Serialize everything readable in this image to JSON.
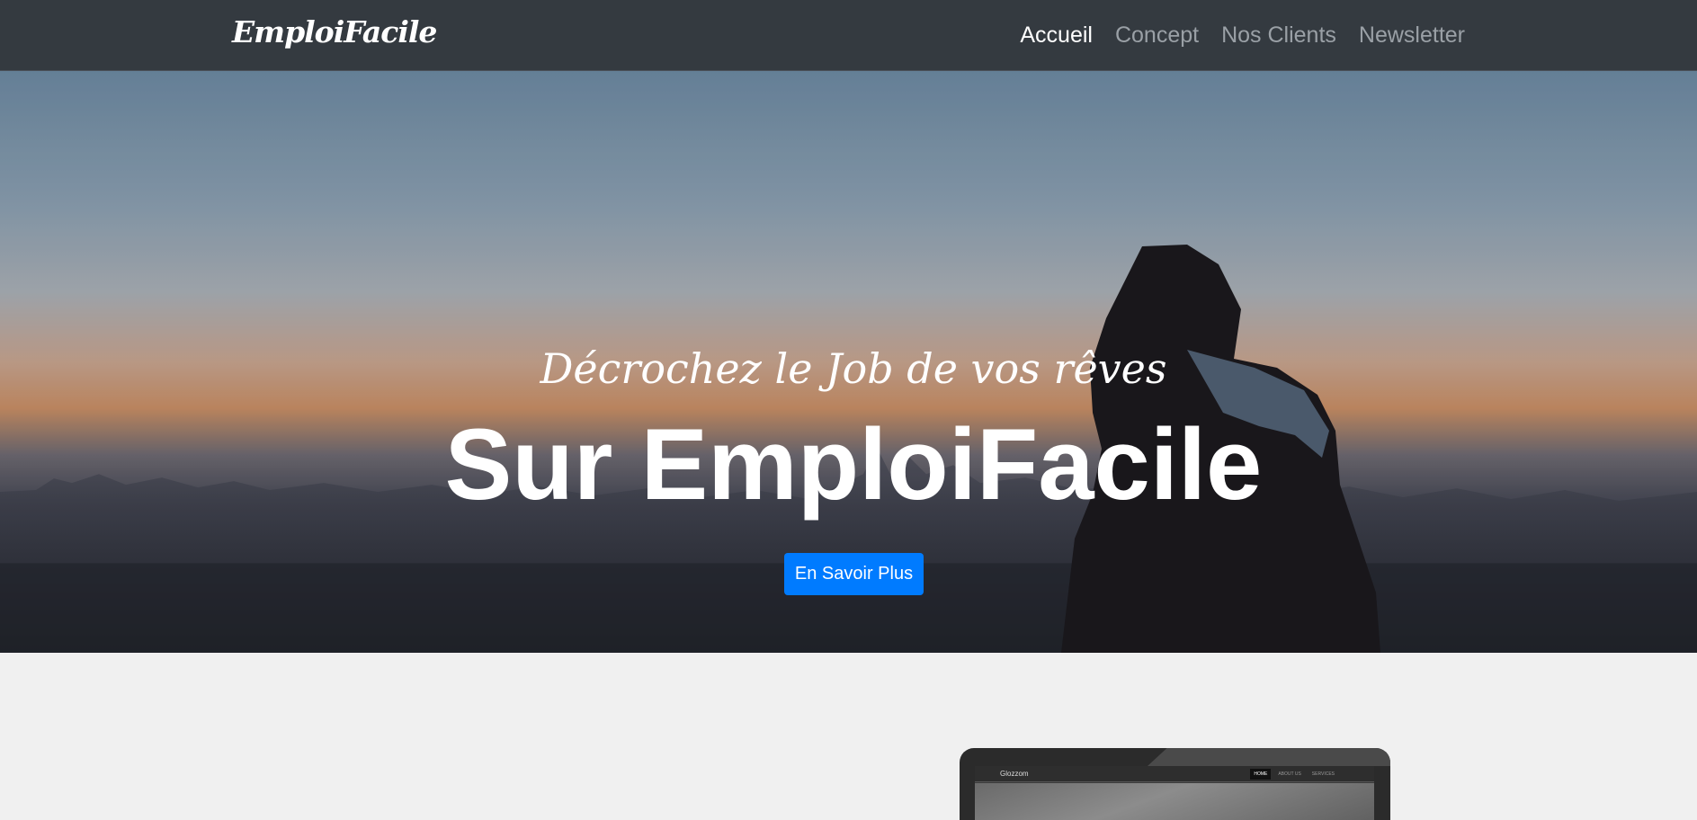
{
  "navbar": {
    "brand": "EmploiFacile",
    "links": [
      {
        "label": "Accueil",
        "active": true
      },
      {
        "label": "Concept",
        "active": false
      },
      {
        "label": "Nos Clients",
        "active": false
      },
      {
        "label": "Newsletter",
        "active": false
      }
    ]
  },
  "hero": {
    "subtitle": "Décrochez le Job de vos rêves",
    "title": "Sur EmploiFacile",
    "button_label": "En Savoir Plus"
  },
  "laptop_preview": {
    "brand": "Glozzom",
    "menu": [
      {
        "label": "HOME",
        "active": true
      },
      {
        "label": "ABOUT US",
        "active": false
      },
      {
        "label": "SERVICES",
        "active": false
      }
    ]
  },
  "colors": {
    "navbar_bg": "#343a40",
    "primary_button": "#007bff",
    "page_bg": "#f0f0f0"
  }
}
